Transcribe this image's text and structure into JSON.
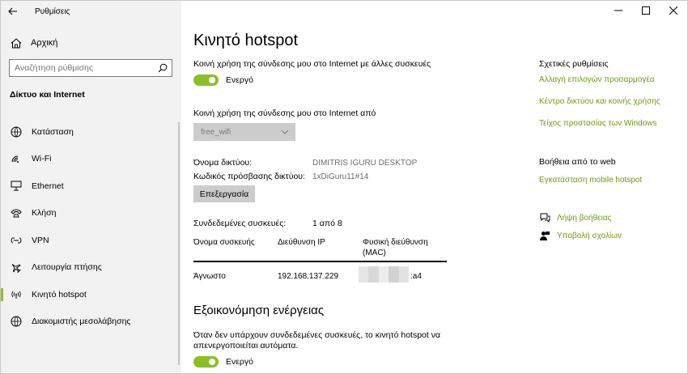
{
  "app": {
    "title": "Ρυθμίσεις"
  },
  "sidebar": {
    "home_label": "Αρχική",
    "search_placeholder": "Αναζήτηση ρύθμισης",
    "section_title": "Δίκτυο και Internet",
    "items": [
      {
        "label": "Κατάσταση",
        "icon": "status-icon"
      },
      {
        "label": "Wi-Fi",
        "icon": "wifi-icon"
      },
      {
        "label": "Ethernet",
        "icon": "ethernet-icon"
      },
      {
        "label": "Κλήση",
        "icon": "dialup-icon"
      },
      {
        "label": "VPN",
        "icon": "vpn-icon"
      },
      {
        "label": "Λειτουργία πτήσης",
        "icon": "airplane-icon"
      },
      {
        "label": "Κινητό hotspot",
        "icon": "hotspot-icon",
        "active": true
      },
      {
        "label": "Διακομιστής μεσολάβησης",
        "icon": "proxy-icon"
      }
    ]
  },
  "main": {
    "title": "Κινητό hotspot",
    "share_label": "Κοινή χρήση της σύνδεσης μου στο Internet με άλλες συσκευές",
    "share_toggle": "Ενεργό",
    "share_from_label": "Κοινή χρήση της σύνδεσης μου στο Internet από",
    "share_from_value": "free_wifi",
    "network_name_label": "Όνομα δικτύου:",
    "network_name_value": "DIMITRIS IGURU DESKTOP",
    "password_label": "Κωδικός πρόσβασης δικτύου:",
    "password_value": "1xDiGuru11#14",
    "edit_button": "Επεξεργασία",
    "connected_label": "Συνδεδεμένες συσκευές:",
    "connected_value": "1 από 8",
    "table": {
      "headers": [
        "Όνομα συσκευής",
        "Διεύθυνση IP",
        "Φυσική διεύθυνση (MAC)"
      ],
      "rows": [
        {
          "name": "Άγνωστο",
          "ip": "192.168.137.229",
          "mac_suffix": ":a4"
        }
      ]
    },
    "power_title": "Εξοικονόμηση ενέργειας",
    "power_desc": "Όταν δεν υπάρχουν συνδεδεμένες συσκευές, το κινητό hotspot να απενεργοποιείται αυτόματα.",
    "power_toggle": "Ενεργό"
  },
  "related": {
    "title": "Σχετικές ρυθμίσεις",
    "links": [
      "Αλλαγή επιλογών προσαρμογέα",
      "Κέντρο δικτύου και κοινής χρήσης",
      "Τείχος προστασίας των Windows"
    ],
    "help_title": "Βοήθεια από το web",
    "help_link": "Εγκατάσταση mobile hotspot",
    "get_help": "Λήψη βοήθειας",
    "feedback": "Υποβολή σχολίων"
  },
  "colors": {
    "accent": "#8cbf26",
    "link": "#6f9a14",
    "sidebar_bg": "#f2f2f2"
  }
}
